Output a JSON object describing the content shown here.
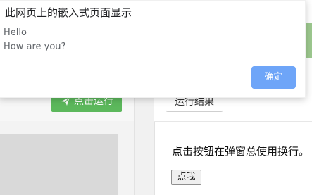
{
  "dialog": {
    "title": "此网页上的嵌入式页面显示",
    "message_lines": [
      "Hello",
      "How are you?"
    ],
    "confirm_label": "确定"
  },
  "toolbar": {
    "run_label": "点击运行",
    "result_label": "运行结果"
  },
  "result": {
    "text": "点击按钮在弹窗总使用换行。",
    "button_label": "点我"
  },
  "colors": {
    "run_button": "#5cb85c",
    "confirm_button": "#6ea5f8",
    "accent_strip": "#9dc98f"
  },
  "icons": {
    "run_icon": "paper-plane-icon"
  }
}
